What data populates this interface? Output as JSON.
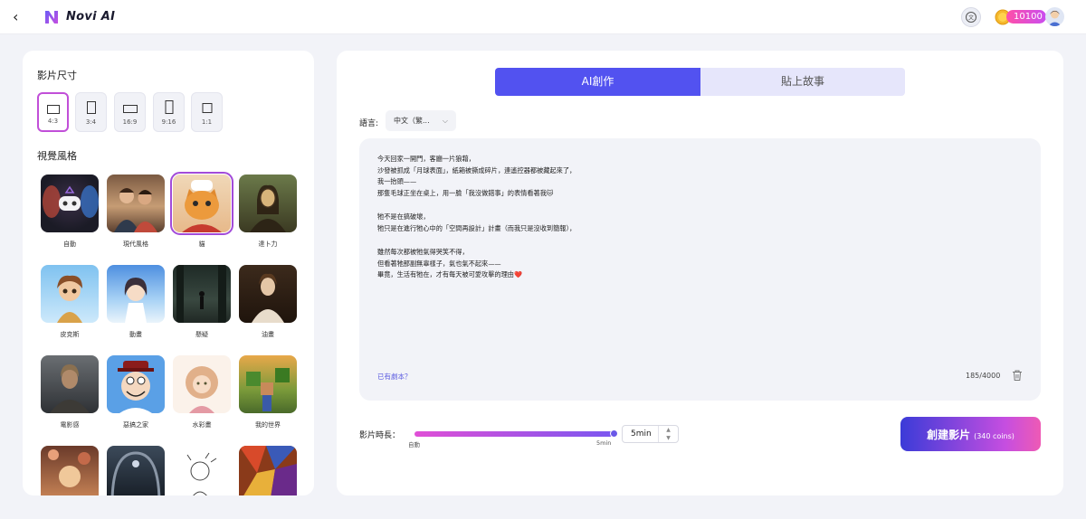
{
  "header": {
    "back_icon": "back-arrow-icon",
    "brand": "Novi AI",
    "coins": "10100"
  },
  "left_panel": {
    "size_title": "影片尺寸",
    "sizes": [
      {
        "label": "4:3",
        "selected": true
      },
      {
        "label": "3:4",
        "selected": false
      },
      {
        "label": "16:9",
        "selected": false
      },
      {
        "label": "9:16",
        "selected": false
      },
      {
        "label": "1:1",
        "selected": false
      }
    ],
    "style_title": "視覺風格",
    "styles": [
      {
        "label": "自動",
        "selected": false
      },
      {
        "label": "現代風格",
        "selected": false
      },
      {
        "label": "貓",
        "selected": true
      },
      {
        "label": "達卜力",
        "selected": false
      },
      {
        "label": "皮克斯",
        "selected": false
      },
      {
        "label": "動畫",
        "selected": false
      },
      {
        "label": "懸疑",
        "selected": false
      },
      {
        "label": "油畫",
        "selected": false
      },
      {
        "label": "電影感",
        "selected": false
      },
      {
        "label": "惡搞之家",
        "selected": false
      },
      {
        "label": "水彩畫",
        "selected": false
      },
      {
        "label": "我的世界",
        "selected": false
      }
    ]
  },
  "right_panel": {
    "tabs": [
      {
        "label": "AI創作",
        "active": true
      },
      {
        "label": "貼上故事",
        "active": false
      }
    ],
    "language_label": "語言:",
    "language_value": "中文（繁...",
    "story_lines": [
      "今天回家一開門，客廳一片狼藉，",
      "沙發被抓成「月球表面」，紙箱被撕成碎片，連遙控器都被藏起來了，",
      "我一抬頭——",
      "那隻毛球正坐在桌上，用一臉「我沒做錯事」的表情看著我🐱",
      "",
      "牠不是在搞破壞，",
      "牠只是在進行牠心中的「空間再設計」計畫（而我只是沒收到簡報），",
      "",
      "雖然每次都被牠氣得哭笑不得，",
      "但看著牠那副無辜樣子，氣也氣不起來——",
      "畢竟，生活有牠在，才有每天被可愛攻擊的理由❤️"
    ],
    "script_link": "已有劇本？",
    "char_count": "185/4000",
    "duration_label": "影片時長：",
    "slider_min": "自動",
    "slider_max": "5min",
    "duration_value": "5min",
    "duration_fraction": 1.0,
    "create_label": "創建影片",
    "create_cost": "(340 coins)"
  },
  "colors": {
    "accent": "#5252f0",
    "selected_border": "#c14fd8",
    "background": "#f2f3f8"
  }
}
